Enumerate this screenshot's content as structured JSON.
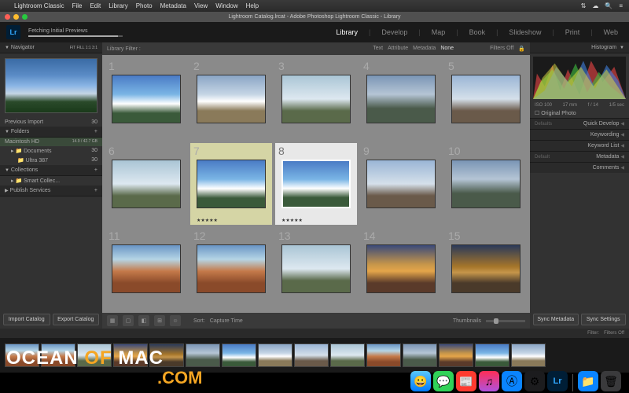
{
  "menubar": {
    "app": "Lightroom Classic",
    "items": [
      "File",
      "Edit",
      "Library",
      "Photo",
      "Metadata",
      "View",
      "Window",
      "Help"
    ]
  },
  "window": {
    "title": "Lightroom Catalog.lrcat - Adobe Photoshop Lightroom Classic - Library"
  },
  "logo": "Lr",
  "status": {
    "text": "Fetching Initial Previews"
  },
  "modules": [
    "Library",
    "Develop",
    "Map",
    "Book",
    "Slideshow",
    "Print",
    "Web"
  ],
  "active_module": "Library",
  "left": {
    "navigator": {
      "title": "Navigator",
      "opts": "FIT  FILL  1:1  3:1"
    },
    "prev_import": {
      "label": "Previous Import",
      "count": "30"
    },
    "folders": {
      "title": "Folders",
      "volume": {
        "name": "Macintosh HD",
        "size": "14.9 / 42.7 GB"
      },
      "items": [
        {
          "name": "Documents",
          "count": "30"
        },
        {
          "name": "Ultra 387",
          "count": "30"
        }
      ]
    },
    "collections": {
      "title": "Collections",
      "items": [
        {
          "name": "Smart Collec..."
        }
      ]
    },
    "publish": {
      "title": "Publish Services"
    },
    "buttons": {
      "import": "Import Catalog",
      "export": "Export Catalog"
    }
  },
  "filterbar": {
    "label": "Library Filter :",
    "tabs": [
      "Text",
      "Attribute",
      "Metadata",
      "None"
    ],
    "right": "Filters Off"
  },
  "grid": {
    "cells": [
      1,
      2,
      3,
      4,
      5,
      6,
      7,
      8,
      9,
      10,
      11,
      12,
      13,
      14,
      15
    ],
    "selected": [
      7,
      8
    ],
    "stars": "★★★★★"
  },
  "toolbar": {
    "sort_label": "Sort:",
    "sort_value": "Capture Time",
    "thumb_label": "Thumbnails"
  },
  "right": {
    "histogram": {
      "title": "Histogram",
      "iso": "ISO 100",
      "focal": "17 mm",
      "aperture": "f / 14",
      "shutter": "1/5 sec",
      "original": "Original Photo"
    },
    "panels": [
      {
        "label": "Quick Develop",
        "prefix": "Defaults"
      },
      {
        "label": "Keywording"
      },
      {
        "label": "Keyword List"
      },
      {
        "label": "Metadata",
        "prefix": "Default"
      },
      {
        "label": "Comments"
      }
    ],
    "buttons": {
      "meta": "Sync Metadata",
      "settings": "Sync Settings"
    }
  },
  "filmstrip": {
    "filter": "Filter:",
    "off": "Filters Off"
  },
  "watermark": {
    "p1": "OCEAN",
    "p2": "OF",
    "p3": "MAC",
    "p4": ".COM"
  }
}
